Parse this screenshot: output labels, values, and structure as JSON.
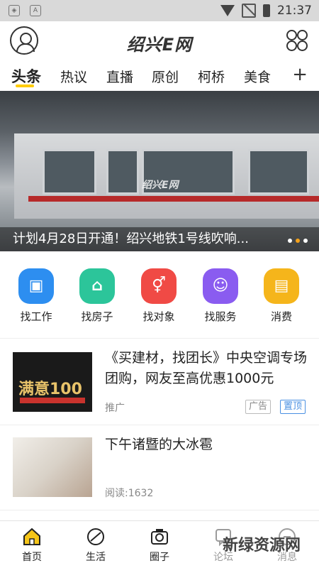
{
  "status_bar": {
    "time": "21:37"
  },
  "header": {
    "logo": "绍兴E网"
  },
  "tabs": [
    {
      "label": "头条"
    },
    {
      "label": "热议"
    },
    {
      "label": "直播"
    },
    {
      "label": "原创"
    },
    {
      "label": "柯桥"
    },
    {
      "label": "美食"
    }
  ],
  "tabs_more": "+",
  "banner": {
    "caption": "计划4月28日开通！绍兴地铁1号线吹响...",
    "watermark": "绍兴E网"
  },
  "services": [
    {
      "label": "找工作",
      "icon": "briefcase-icon",
      "color": "#2d8ef0"
    },
    {
      "label": "找房子",
      "icon": "house-icon",
      "color": "#2cc59a"
    },
    {
      "label": "找对象",
      "icon": "gender-icon",
      "color": "#f04a45"
    },
    {
      "label": "找服务",
      "icon": "service-icon",
      "color": "#8a5cf0"
    },
    {
      "label": "消费",
      "icon": "shop-icon",
      "color": "#f5b51b"
    }
  ],
  "news": [
    {
      "title": "《买建材，找团长》中央空调专场团购，网友至高优惠1000元",
      "meta": "推广",
      "tags": [
        "广告",
        "置顶"
      ],
      "thumb_text": "满意100"
    },
    {
      "title": "下午诸暨的大冰雹",
      "meta": "阅读:1632"
    }
  ],
  "bottom_nav": [
    {
      "label": "首页",
      "icon": "home-icon"
    },
    {
      "label": "生活",
      "icon": "life-icon"
    },
    {
      "label": "圈子",
      "icon": "camera-icon"
    },
    {
      "label": "论坛",
      "icon": "forum-icon"
    },
    {
      "label": "消息",
      "icon": "message-icon"
    }
  ],
  "watermark": "新绿资源网"
}
